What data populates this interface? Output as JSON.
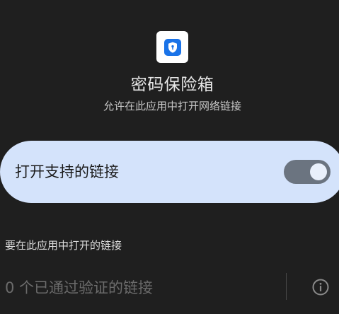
{
  "app": {
    "name": "密码保险箱",
    "icon": "password-vault-shield-icon",
    "subtitle": "允许在此应用中打开网络链接"
  },
  "open_supported_links": {
    "label": "打开支持的链接",
    "enabled": true
  },
  "links_section": {
    "header": "要在此应用中打开的链接",
    "verified_links_text": "0 个已通过验证的链接",
    "info_icon": "info-icon"
  },
  "colors": {
    "background": "#1f1f1f",
    "card": "#d4e3fb",
    "switch_track": "#6b7480",
    "icon_blue": "#1a73e8"
  }
}
